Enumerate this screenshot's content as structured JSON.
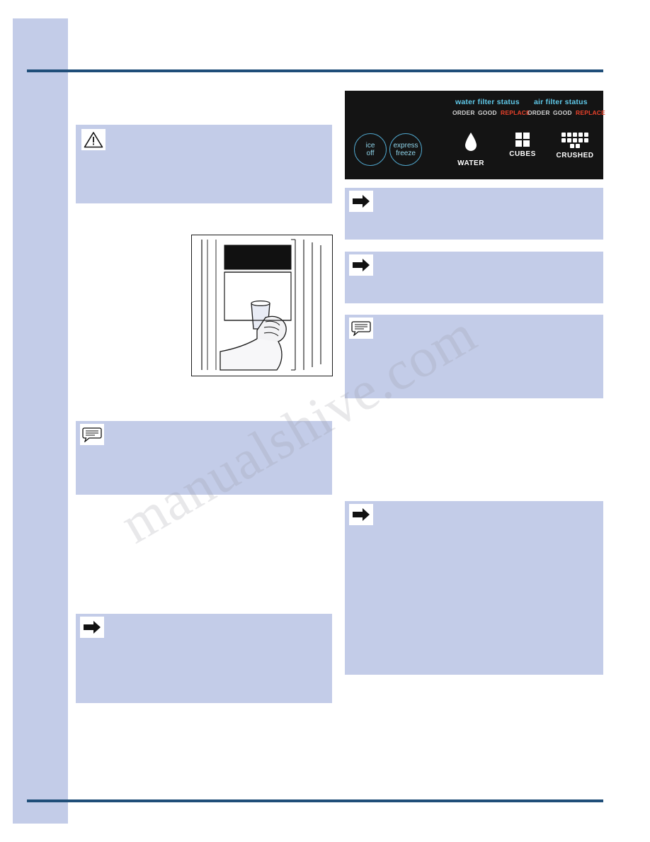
{
  "page": {
    "watermark": "manualshive.com"
  },
  "colors": {
    "accent_rule": "#1f4e79",
    "callout_bg": "#c3cce8",
    "panel_bg": "#141414",
    "filter_heading": "#5fc8e8",
    "status_replace": "#e8412a",
    "status_neutral": "#cfcfcf"
  },
  "control_panel": {
    "water_filter_status_label": "water filter status",
    "air_filter_status_label": "air filter status",
    "water_filter_states": [
      "ORDER",
      "GOOD",
      "REPLACE"
    ],
    "air_filter_states": [
      "ORDER",
      "GOOD",
      "REPLACE"
    ],
    "buttons": [
      {
        "line1": "ice",
        "line2": "off"
      },
      {
        "line1": "express",
        "line2": "freeze"
      }
    ],
    "dispense": [
      {
        "label": "WATER",
        "icon": "water-drop-icon"
      },
      {
        "label": "CUBES",
        "icon": "ice-cubes-icon"
      },
      {
        "label": "CRUSHED",
        "icon": "crushed-ice-icon"
      }
    ]
  },
  "callouts": {
    "left": [
      {
        "name": "warning-callout",
        "icon": "warning-triangle-icon",
        "text": ""
      },
      {
        "name": "note-callout",
        "icon": "note-bubble-icon",
        "text": ""
      },
      {
        "name": "important-callout",
        "icon": "arrow-right-icon",
        "text": ""
      }
    ],
    "right": [
      {
        "name": "important-callout-1",
        "icon": "arrow-right-icon",
        "text": ""
      },
      {
        "name": "important-callout-2",
        "icon": "arrow-right-icon",
        "text": ""
      },
      {
        "name": "note-callout-right",
        "icon": "note-bubble-icon",
        "text": ""
      },
      {
        "name": "important-callout-3",
        "icon": "arrow-right-icon",
        "text": ""
      }
    ]
  },
  "illustration": {
    "name": "dispenser-illustration",
    "description": "hand holding glass at refrigerator water dispenser"
  }
}
